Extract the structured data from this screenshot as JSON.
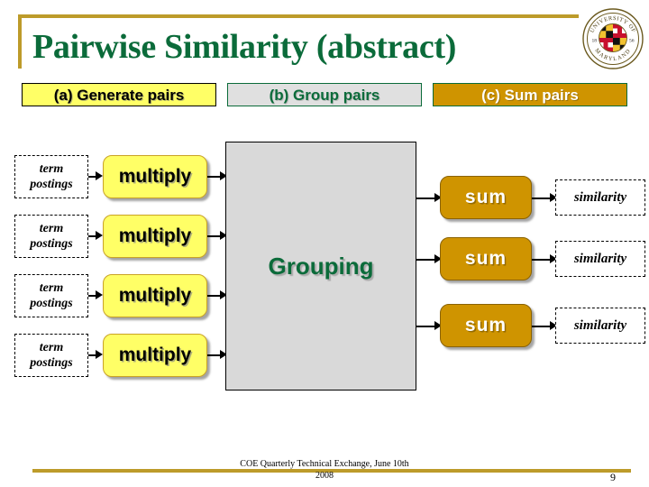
{
  "slide": {
    "title": "Pairwise Similarity (abstract)",
    "logo": {
      "name": "university-of-maryland-seal",
      "top_text": "UNIVERSITY OF",
      "bottom_text": "MARYLAND",
      "year_left": "18",
      "year_right": "56"
    },
    "phases": [
      {
        "id": "a",
        "label": "(a) Generate pairs",
        "bg": "#ffff66",
        "fg": "#000000",
        "border": "#000000"
      },
      {
        "id": "b",
        "label": "(b) Group pairs",
        "bg": "#e0e0e0",
        "fg": "#0b6b3a",
        "border": "#0b6b3a"
      },
      {
        "id": "c",
        "label": "(c) Sum pairs",
        "bg": "#cf9400",
        "fg": "#ffffff",
        "border": "#0b6b3a"
      }
    ],
    "diagram": {
      "input_label": "term postings",
      "input_line1": "term",
      "input_line2": "postings",
      "process_label": "multiply",
      "group_label": "Grouping",
      "sum_label": "sum",
      "output_label": "similarity",
      "input_rows": [
        {
          "line1": "term",
          "line2": "postings",
          "process": "multiply"
        },
        {
          "line1": "term",
          "line2": "postings",
          "process": "multiply"
        },
        {
          "line1": "term",
          "line2": "postings",
          "process": "multiply"
        },
        {
          "line1": "term",
          "line2": "postings",
          "process": "multiply"
        }
      ],
      "output_rows": [
        {
          "sum": "sum",
          "similarity": "similarity"
        },
        {
          "sum": "sum",
          "similarity": "similarity"
        },
        {
          "sum": "sum",
          "similarity": "similarity"
        }
      ]
    },
    "footer": {
      "line1": "COE Quarterly Technical Exchange, June 10th",
      "line2": "2008",
      "slide_number": "9"
    },
    "colors": {
      "green": "#0b6b3a",
      "gold": "#bd9b2a",
      "yellow": "#ffff66",
      "goldenrod": "#cf9400",
      "gray": "#d9d9d9"
    }
  }
}
